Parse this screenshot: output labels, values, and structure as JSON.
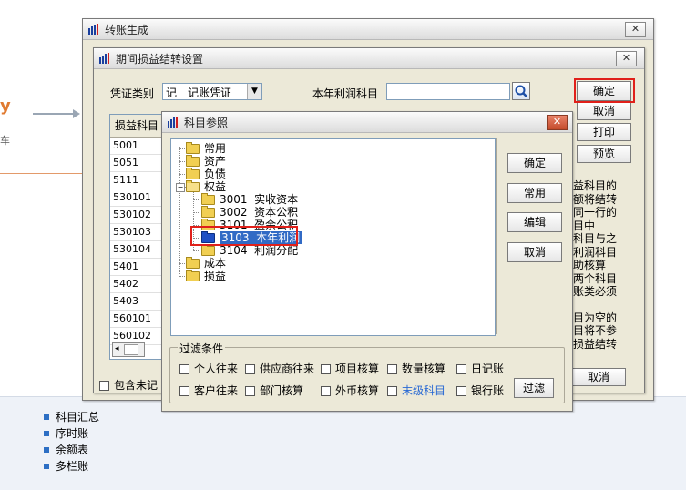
{
  "background": {
    "sidebar_links": [
      "科目汇总",
      "序时账",
      "余额表",
      "多栏账"
    ],
    "orange_mark": "y",
    "left_char": "车"
  },
  "win_transfer": {
    "title": "转账生成",
    "close_glyph": "✕"
  },
  "win_period": {
    "title": "期间损益结转设置",
    "close_glyph": "✕",
    "voucher_type_label": "凭证类别",
    "voucher_type_value": "记　记账凭证",
    "profit_account_label": "本年利润科目",
    "profit_account_value": "",
    "buttons": {
      "ok": "确定",
      "cancel": "取消",
      "print": "打印",
      "preview": "预览"
    },
    "list_header": "损益科目",
    "list_rows": [
      "5001",
      "5051",
      "5111",
      "530101",
      "530102",
      "530103",
      "530104",
      "5401",
      "5402",
      "5403",
      "560101",
      "560102"
    ],
    "include_unbooked_label": "包含未记",
    "bottom_cancel": "取消",
    "right_partial_text": [
      "益科目的",
      "额将结转",
      "同一行的",
      "目中",
      "科目与之",
      "利润科目",
      "助核算",
      "两个科目",
      "账类必须",
      "",
      "目为空的",
      "目将不参",
      "损益结转"
    ]
  },
  "win_ref": {
    "title": "科目参照",
    "close_glyph": "✕",
    "tree": [
      {
        "label": "常用"
      },
      {
        "label": "资产"
      },
      {
        "label": "负债"
      },
      {
        "label": "权益",
        "expanded": true
      },
      {
        "label": "3001  实收资本"
      },
      {
        "label": "3002  资本公积"
      },
      {
        "label": "3101  盈余公积"
      },
      {
        "label": "3103  本年利润",
        "selected": true
      },
      {
        "label": "3104  利润分配"
      },
      {
        "label": "成本"
      },
      {
        "label": "损益"
      }
    ],
    "buttons": {
      "ok": "确定",
      "common": "常用",
      "edit": "编辑",
      "cancel": "取消"
    },
    "filter_title": "过滤条件",
    "filters_row1": [
      "个人往来",
      "供应商往来",
      "项目核算",
      "数量核算",
      "日记账"
    ],
    "filters_row2": [
      "客户往来",
      "部门核算",
      "外币核算",
      "末级科目",
      "银行账"
    ],
    "filter_button": "过滤",
    "highlight_color": "#e0201a"
  }
}
